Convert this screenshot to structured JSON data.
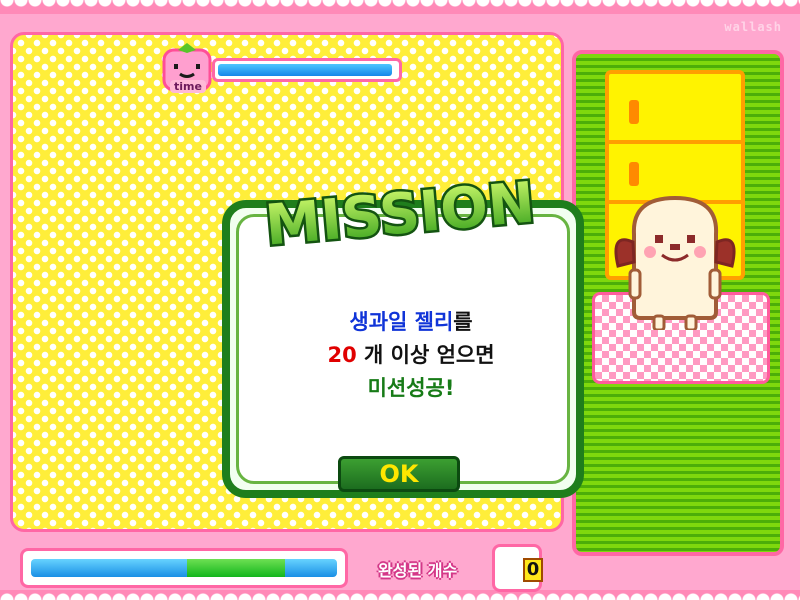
{
  "watermark": "wallash",
  "timer": {
    "label": "time",
    "fill_fraction": 0.98
  },
  "mission": {
    "title": "MISSION",
    "line1_part1": "생과일 젤리",
    "line1_part2": "를",
    "line2_number": "20",
    "line2_rest": " 개 이상 얻으면",
    "line3": "미션성공!",
    "ok_label": "OK"
  },
  "progress": {
    "green_start_fraction": 0.51,
    "green_end_fraction": 0.83
  },
  "completed": {
    "label": "완성된 개수",
    "value": "0"
  },
  "colors": {
    "pink": "#ff67a5",
    "yellow": "#ffee3a",
    "green_dark": "#1f7e1c",
    "blue": "#1034d8",
    "red": "#e00000"
  }
}
